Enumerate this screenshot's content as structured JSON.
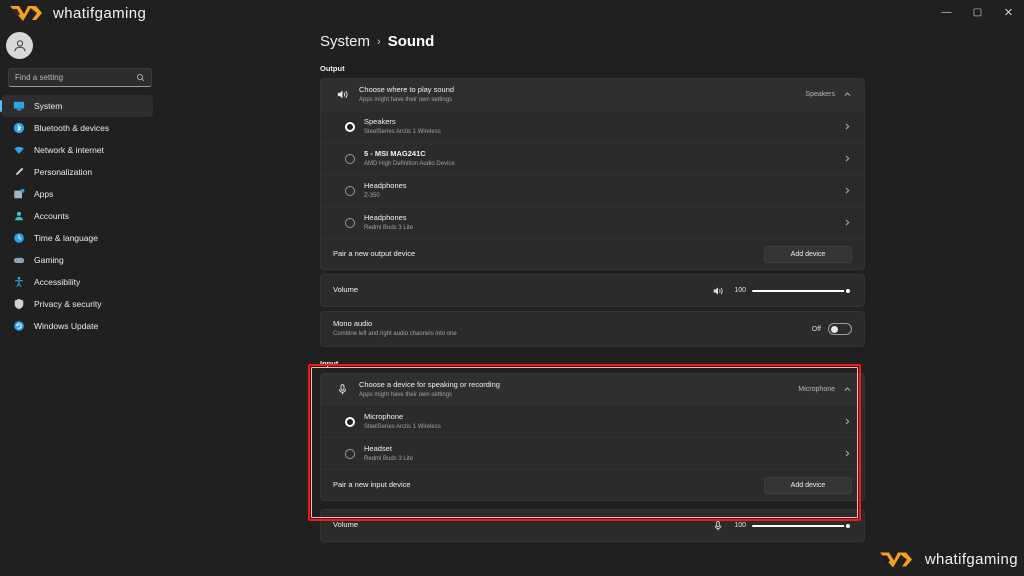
{
  "titlebar": {
    "brand": "whatifgaming",
    "brand_color": "#f5a01f",
    "minimize": "—",
    "maximize": "▢",
    "close": "✕"
  },
  "sidebar": {
    "search": {
      "placeholder": "Find a setting",
      "value": "",
      "icon": "search-icon"
    },
    "avatar_icon": "person-icon",
    "items": [
      {
        "label": "System",
        "icon": "system-icon",
        "selected": true
      },
      {
        "label": "Bluetooth & devices",
        "icon": "bluetooth-icon",
        "selected": false
      },
      {
        "label": "Network & internet",
        "icon": "wifi-icon",
        "selected": false
      },
      {
        "label": "Personalization",
        "icon": "brush-icon",
        "selected": false
      },
      {
        "label": "Apps",
        "icon": "apps-icon",
        "selected": false
      },
      {
        "label": "Accounts",
        "icon": "accounts-icon",
        "selected": false
      },
      {
        "label": "Time & language",
        "icon": "clock-icon",
        "selected": false
      },
      {
        "label": "Gaming",
        "icon": "gamepad-icon",
        "selected": false
      },
      {
        "label": "Accessibility",
        "icon": "accessibility-icon",
        "selected": false
      },
      {
        "label": "Privacy & security",
        "icon": "shield-icon",
        "selected": false
      },
      {
        "label": "Windows Update",
        "icon": "update-icon",
        "selected": false
      }
    ]
  },
  "breadcrumb": {
    "root": "System",
    "separator": "›",
    "leaf": "Sound"
  },
  "output": {
    "section_label": "Output",
    "chooser": {
      "title": "Choose where to play sound",
      "subtitle": "Apps might have their own settings",
      "value": "Speakers",
      "chevron": "⌃",
      "icon": "speaker-icon"
    },
    "devices": [
      {
        "name": "Speakers",
        "detail": "SteelSeries Arctis 1 Wireless",
        "selected": true
      },
      {
        "name": "5 - MSI MAG241C",
        "detail": "AMD High Definition Audio Device",
        "selected": false
      },
      {
        "name": "Headphones",
        "detail": "Z-350",
        "selected": false
      },
      {
        "name": "Headphones",
        "detail": "Redmi Buds 3 Lite",
        "selected": false
      }
    ],
    "pair": {
      "label": "Pair a new output device",
      "button": "Add device"
    },
    "volume": {
      "label": "Volume",
      "value": "100",
      "percent": 100,
      "icon": "speaker-icon"
    },
    "mono": {
      "title": "Mono audio",
      "subtitle": "Combine left and right audio channels into one",
      "state": "Off",
      "on": false
    }
  },
  "input": {
    "section_label": "Input",
    "highlighted": true,
    "highlight_color": "#ff1414",
    "chooser": {
      "title": "Choose a device for speaking or recording",
      "subtitle": "Apps might have their own settings",
      "value": "Microphone",
      "chevron": "⌃",
      "icon": "microphone-icon"
    },
    "devices": [
      {
        "name": "Microphone",
        "detail": "SteelSeries Arctis 1 Wireless",
        "selected": true
      },
      {
        "name": "Headset",
        "detail": "Redmi Buds 3 Lite",
        "selected": false
      }
    ],
    "pair": {
      "label": "Pair a new input device",
      "button": "Add device"
    },
    "volume": {
      "label": "Volume",
      "value": "100",
      "percent": 100,
      "icon": "microphone-icon"
    }
  },
  "watermark": {
    "brand": "whatifgaming"
  }
}
